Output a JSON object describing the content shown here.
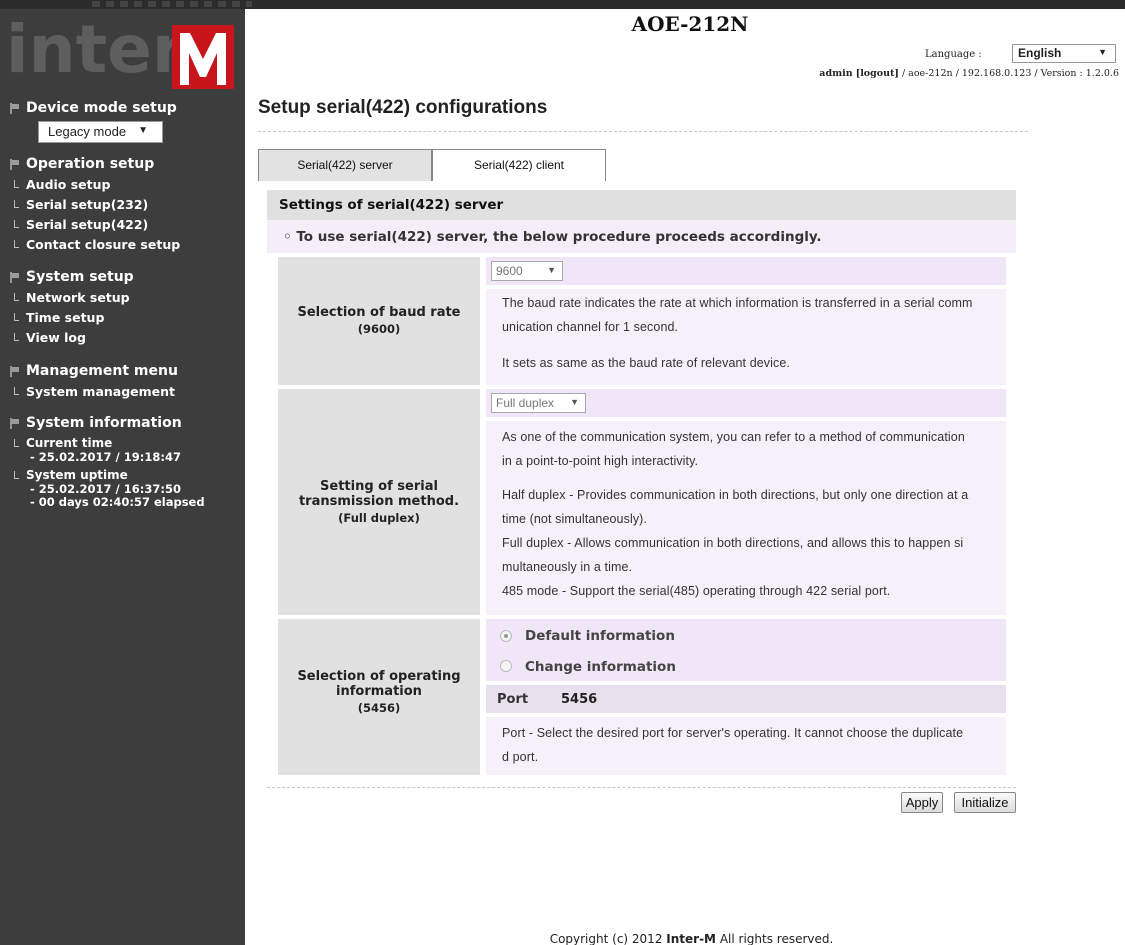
{
  "header": {
    "device_title": "AOE-212N",
    "language_label": "Language :",
    "language_value": "English",
    "user": "admin",
    "logout": "[logout]",
    "info_tail": " / aoe-212n / 192.168.0.123 / Version : 1.2.0.6"
  },
  "sidebar": {
    "logo": "inter",
    "device_mode": {
      "label": "Device mode setup",
      "select_value": "Legacy mode"
    },
    "operation": {
      "label": "Operation setup",
      "items": [
        "Audio setup",
        "Serial setup(232)",
        "Serial setup(422)",
        "Contact closure setup"
      ]
    },
    "system": {
      "label": "System setup",
      "items": [
        "Network setup",
        "Time setup",
        "View log"
      ]
    },
    "management": {
      "label": "Management menu",
      "items": [
        "System management"
      ]
    },
    "information": {
      "label": "System information",
      "current_time_label": "Current time",
      "current_time_value": "- 25.02.2017 / 19:18:47",
      "uptime_label": "System uptime",
      "uptime_start": "- 25.02.2017 / 16:37:50",
      "uptime_elapsed": "- 00 days 02:40:57 elapsed"
    }
  },
  "main": {
    "page_title": "Setup serial(422) configurations",
    "tabs": [
      {
        "label": "Serial(422) server",
        "active": true
      },
      {
        "label": "Serial(422) client",
        "active": false
      }
    ],
    "section_title": "Settings of serial(422) server",
    "section_note": "◦ To use serial(422) server, the below procedure proceeds accordingly.",
    "baud": {
      "label": "Selection of baud rate",
      "sub": "(9600)",
      "select_value": "9600",
      "lines": [
        "The baud rate indicates the rate at which information is transferred in a serial comm",
        "unication channel for 1 second.",
        "It sets as same as the baud rate of relevant device."
      ]
    },
    "method": {
      "label_line1": "Setting of serial",
      "label_line2": "transmission method.",
      "sub": "(Full duplex)",
      "select_value": "Full duplex",
      "lines": [
        "As one of the communication system, you can refer to a method of communication",
        "in a point-to-point high interactivity.",
        "Half duplex - Provides communication in both directions, but only one direction at a",
        "time (not simultaneously).",
        "Full duplex - Allows communication in both directions, and allows this to happen si",
        "multaneously in a time.",
        "485 mode - Support the serial(485) operating through 422 serial port."
      ]
    },
    "operating": {
      "label_line1": "Selection of operating",
      "label_line2": "information",
      "sub": "(5456)",
      "radio_default": "Default information",
      "radio_change": "Change information",
      "port_label": "Port",
      "port_value": "5456",
      "lines": [
        "Port - Select the desired port for server's operating. It cannot choose the duplicate",
        "d port."
      ]
    },
    "buttons": {
      "apply": "Apply",
      "initialize": "Initialize"
    }
  },
  "footer": {
    "prefix": "Copyright (c) 2012 ",
    "brand": "Inter-M",
    "suffix": " All rights reserved."
  },
  "colors": {
    "sidebar_bg": "#3d3d3d",
    "brand_red": "#c8151b",
    "panel_lilac": "#f6f0fa",
    "label_gray": "#e1e1e1"
  }
}
